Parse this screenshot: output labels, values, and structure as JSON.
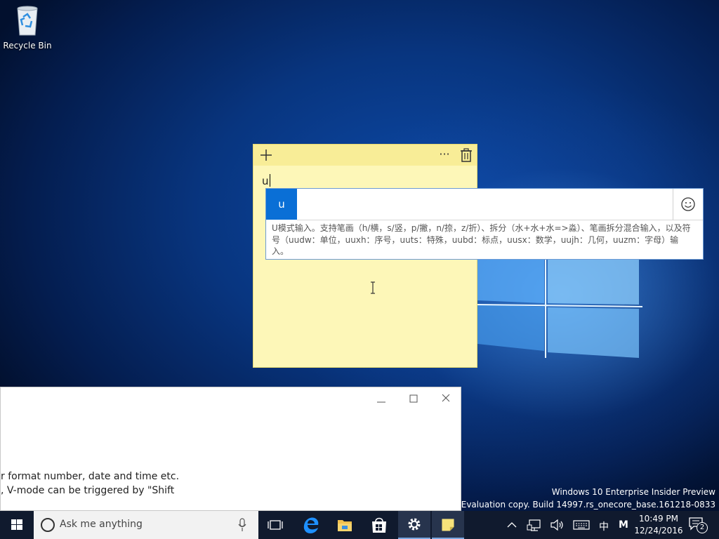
{
  "desktop": {
    "recycle_bin_label": "Recycle Bin"
  },
  "sticky_note": {
    "typed_text": "u",
    "more_glyph": "···"
  },
  "ime": {
    "composition": "u",
    "help_text": "U模式输入。支持笔画（h/横，s/竖，p/撇，n/捺，z/折）、拆分（水+水+水=>淼）、笔画拆分混合输入，以及符号（uudw：单位，uuxh：序号，uuts：特殊，uubd：标点，uusx：数学，uujh：几何，uuzm：字母）输入。"
  },
  "app_window": {
    "line1": "r format number, date and time etc.",
    "line2": ", V-mode can be triggered by \"Shift"
  },
  "watermark": {
    "line1": "Windows 10 Enterprise Insider Preview",
    "line2": "Evaluation copy. Build 14997.rs_onecore_base.161218-0833"
  },
  "taskbar": {
    "search_placeholder": "Ask me anything",
    "ime_lang": "中",
    "ime_mode": "M",
    "time": "10:49 PM",
    "date": "12/24/2016",
    "notification_count": "2"
  },
  "colors": {
    "accent": "#0a6fd6",
    "note_body": "#fdf7b8",
    "note_header": "#f8ed97",
    "taskbar": "#101a2e"
  }
}
